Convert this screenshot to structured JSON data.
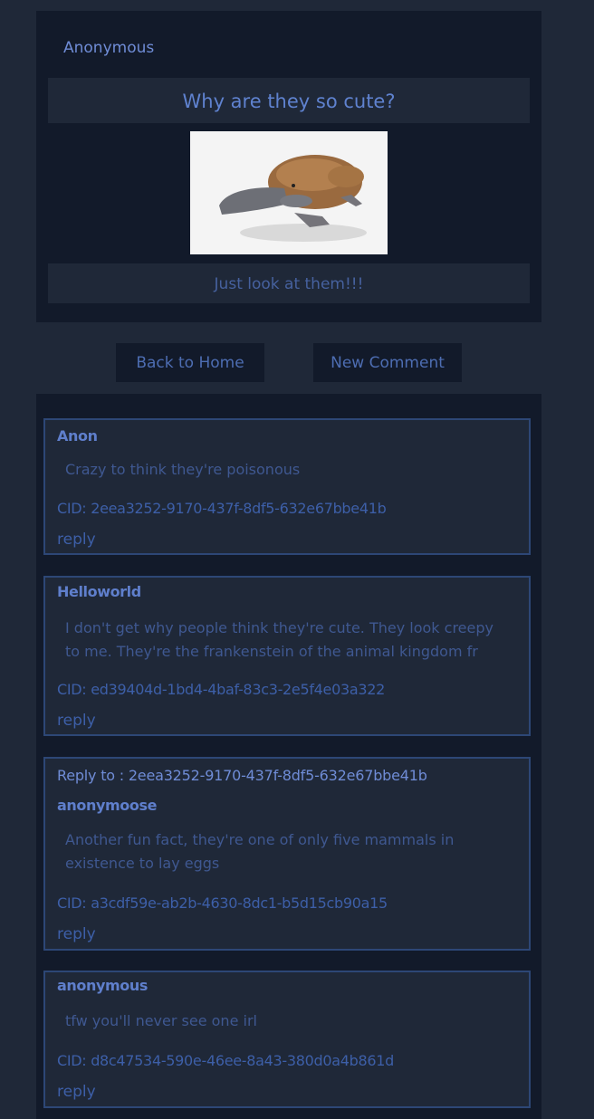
{
  "post": {
    "author": "Anonymous",
    "title": "Why are they so cute?",
    "image_alt": "platypus",
    "body": "Just look at them!!!"
  },
  "actions": {
    "back_label": "Back to Home",
    "new_comment_label": "New Comment"
  },
  "comments": [
    {
      "user": "Anon",
      "text": "Crazy to think they're poisonous",
      "cid": "CID: 2eea3252-9170-437f-8df5-632e67bbe41b",
      "reply_label": "reply"
    },
    {
      "user": "Helloworld",
      "text": "I don't get why people think they're cute. They look creepy to me. They're the frankenstein of the animal kingdom fr",
      "cid": "CID: ed39404d-1bd4-4baf-83c3-2e5f4e03a322",
      "reply_label": "reply"
    },
    {
      "reply_to": "Reply to : 2eea3252-9170-437f-8df5-632e67bbe41b",
      "user": "anonymoose",
      "text": "Another fun fact, they're one of only five mammals in existence to lay eggs",
      "cid": "CID: a3cdf59e-ab2b-4630-8dc1-b5d15cb90a15",
      "reply_label": "reply"
    },
    {
      "user": "anonymous",
      "text": "tfw you'll never see one irl",
      "cid": "CID: d8c47534-590e-46ee-8a43-380d0a4b861d",
      "reply_label": "reply"
    }
  ]
}
